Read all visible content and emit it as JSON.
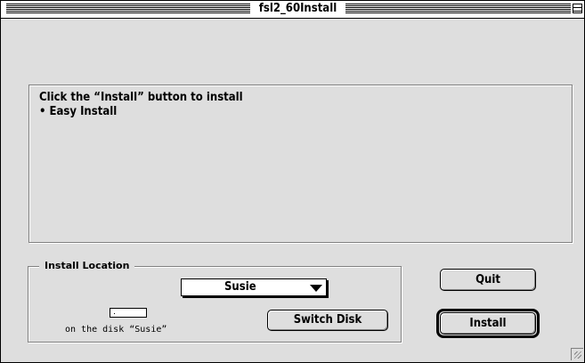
{
  "window": {
    "title": "fsl2_60Install"
  },
  "message": {
    "line1": "Click the “Install” button to install",
    "line2": "• Easy Install"
  },
  "install_location": {
    "legend": "Install Location",
    "selected_disk": "Susie",
    "disk_caption": "on the disk “Susie”"
  },
  "buttons": {
    "switch_disk": "Switch Disk",
    "quit": "Quit",
    "install": "Install"
  },
  "icons": {
    "zoom": "zoom-box-icon",
    "popup_arrow": "down-triangle-icon",
    "disk": "disk-icon",
    "grow": "grow-box-icon"
  }
}
